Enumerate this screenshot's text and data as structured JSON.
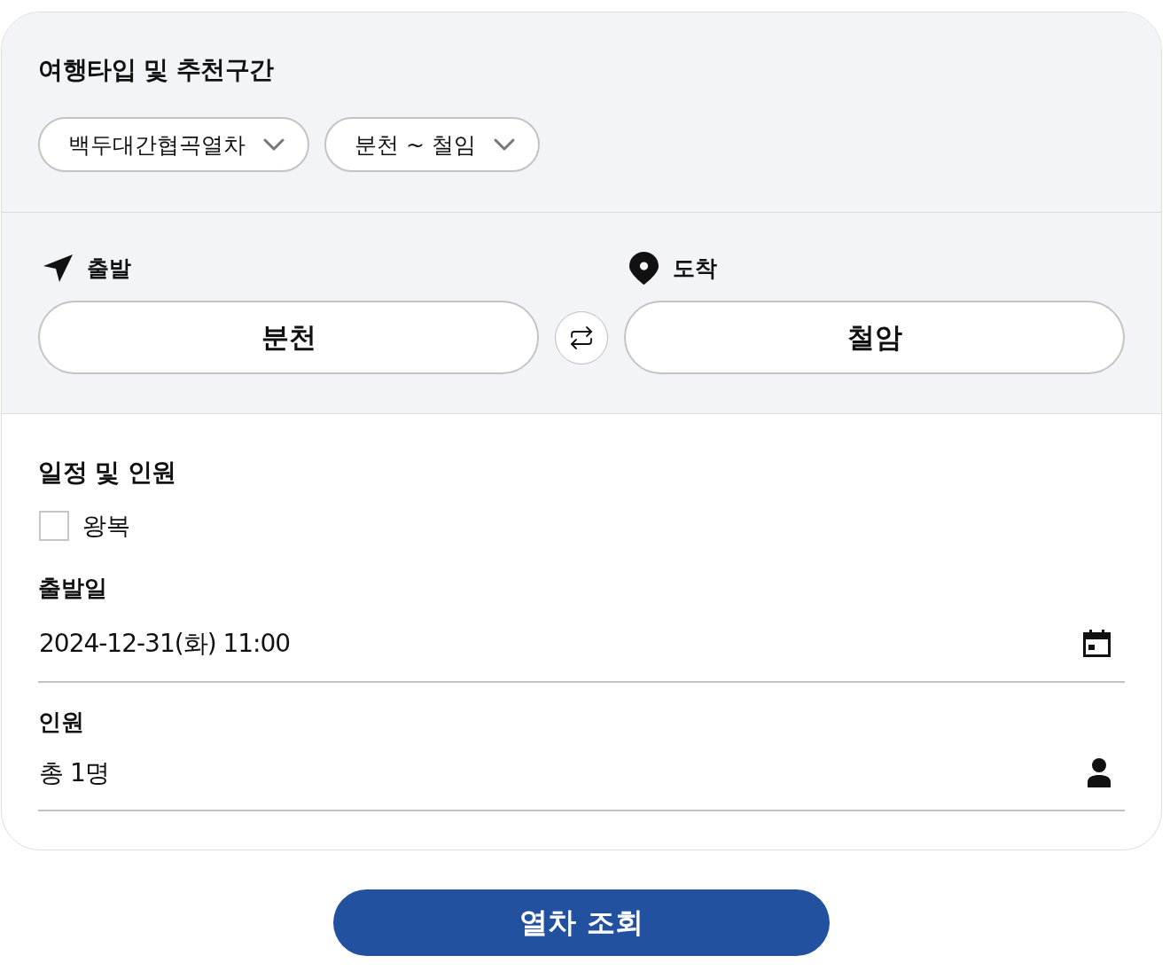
{
  "trip_type": {
    "title": "여행타입 및 추천구간",
    "dropdowns": [
      {
        "value": "백두대간협곡열차"
      },
      {
        "value": "분천 ~ 철임"
      }
    ]
  },
  "stations": [
    {
      "kind": "departure",
      "label": "출발",
      "value": "분천"
    },
    {
      "kind": "arrival",
      "label": "도착",
      "value": "철암"
    }
  ],
  "schedule": {
    "title": "일정 및 인원",
    "round_trip": {
      "label": "왕복",
      "checked": false
    },
    "fields": [
      {
        "kind": "date",
        "label": "출발일",
        "value": "2024-12-31(화) 11:00"
      },
      {
        "kind": "passengers",
        "label": "인원",
        "value": "총 1명"
      }
    ]
  },
  "search_button": {
    "label": "열차 조회"
  }
}
